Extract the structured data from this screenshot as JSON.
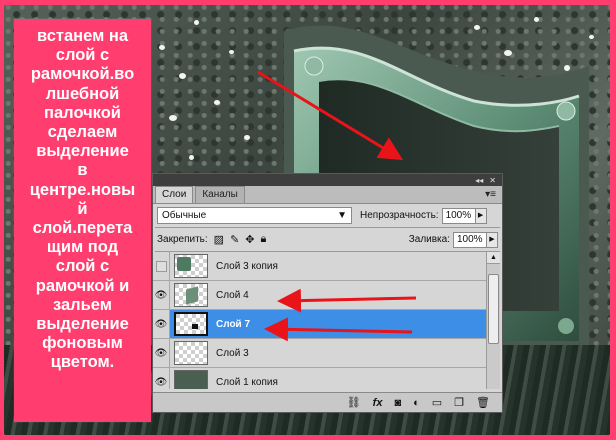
{
  "caption": {
    "lines": [
      "встанем на",
      "слой с",
      "рамочкой.во",
      "лшебной",
      "палочкой",
      "сделаем",
      "выделение",
      "в",
      "центре.новы",
      "й",
      "слой.перета",
      "щим под",
      "слой с",
      "рамочкой и",
      "зальем",
      "выделение",
      "фоновым",
      "цветом."
    ]
  },
  "panel": {
    "tabs": {
      "layers": "Слои",
      "channels": "Каналы"
    },
    "topbar_icons": [
      "collapse-icon",
      "close-icon"
    ],
    "blend_mode": "Обычные",
    "opacity_label": "Непрозрачность:",
    "opacity_value": "100%",
    "lock_label": "Закрепить:",
    "fill_label": "Заливка:",
    "fill_value": "100%",
    "layers": [
      {
        "name": "Слой 3 копия",
        "visible": false
      },
      {
        "name": "Слой 4",
        "visible": true
      },
      {
        "name": "Слой 7",
        "visible": true,
        "selected": true
      },
      {
        "name": "Слой 3",
        "visible": true
      },
      {
        "name": "Слой 1 копия",
        "visible": true
      }
    ],
    "bottom_icons": [
      "link-icon",
      "fx-icon",
      "mask-icon",
      "adjustment-icon",
      "folder-icon",
      "new-layer-icon",
      "trash-icon"
    ]
  },
  "colors": {
    "background": "#ff3d6e",
    "selection": "#3d8ee6",
    "arrow": "#e8141a"
  }
}
